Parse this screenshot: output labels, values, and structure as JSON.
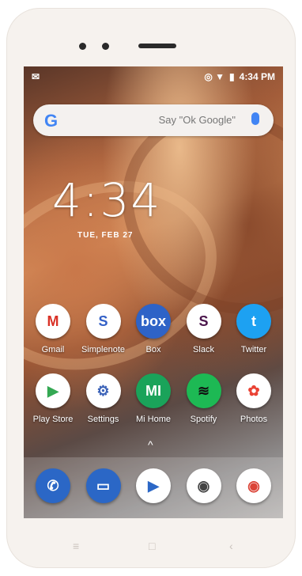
{
  "status": {
    "time": "4:34 PM"
  },
  "search": {
    "logo": "G",
    "placeholder": "Say \"Ok Google\""
  },
  "clock": {
    "time": "4:34",
    "date": "TUE, FEB 27"
  },
  "apps_row1": [
    {
      "label": "Gmail",
      "icon": "gmail-icon",
      "color": "#ffffff",
      "glyph": "M",
      "glyphColor": "#d93025"
    },
    {
      "label": "Simplenote",
      "icon": "simplenote-icon",
      "color": "#ffffff",
      "glyph": "S",
      "glyphColor": "#3360c7"
    },
    {
      "label": "Box",
      "icon": "box-icon",
      "color": "#2e63c7",
      "glyph": "box",
      "glyphColor": "#ffffff"
    },
    {
      "label": "Slack",
      "icon": "slack-icon",
      "color": "#ffffff",
      "glyph": "S",
      "glyphColor": "#4a154b"
    },
    {
      "label": "Twitter",
      "icon": "twitter-icon",
      "color": "#1da1f2",
      "glyph": "t",
      "glyphColor": "#ffffff"
    }
  ],
  "apps_row2": [
    {
      "label": "Play Store",
      "icon": "play-store-icon",
      "color": "#ffffff",
      "glyph": "▶",
      "glyphColor": "#34a853"
    },
    {
      "label": "Settings",
      "icon": "settings-icon",
      "color": "#ffffff",
      "glyph": "⚙",
      "glyphColor": "#3c63b8"
    },
    {
      "label": "Mi Home",
      "icon": "mi-home-icon",
      "color": "#1aa35a",
      "glyph": "MI",
      "glyphColor": "#ffffff"
    },
    {
      "label": "Spotify",
      "icon": "spotify-icon",
      "color": "#1db954",
      "glyph": "≋",
      "glyphColor": "#111111"
    },
    {
      "label": "Photos",
      "icon": "photos-icon",
      "color": "#ffffff",
      "glyph": "✿",
      "glyphColor": "#ea4335"
    }
  ],
  "dock": [
    {
      "icon": "phone-icon",
      "color": "#2b67c6",
      "glyph": "✆",
      "glyphColor": "#ffffff"
    },
    {
      "icon": "messages-icon",
      "color": "#2b67c6",
      "glyph": "▭",
      "glyphColor": "#ffffff"
    },
    {
      "icon": "duo-icon",
      "color": "#ffffff",
      "glyph": "▶",
      "glyphColor": "#2b67c6"
    },
    {
      "icon": "camera-icon",
      "color": "#ffffff",
      "glyph": "◉",
      "glyphColor": "#444444"
    },
    {
      "icon": "chrome-icon",
      "color": "#ffffff",
      "glyph": "◉",
      "glyphColor": "#db4437"
    }
  ]
}
